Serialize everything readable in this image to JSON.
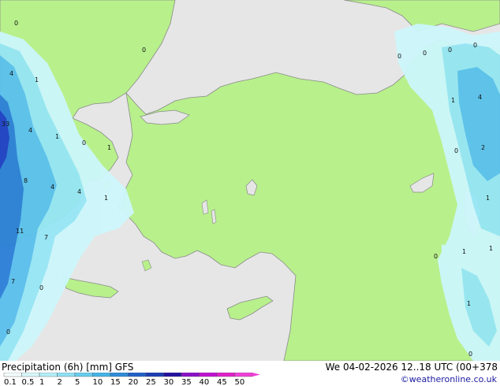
{
  "map": {
    "region": "Turkey / Eastern Mediterranean",
    "colors": {
      "sea": "#e6e6e6",
      "land": "#b8f08c",
      "coast": "#8a8a8a",
      "precip_light": "#cdf7fc",
      "precip_mid": "#96e6f5",
      "precip_heavy": "#5ac0ee",
      "precip_strong": "#2a7fd8",
      "precip_max": "#1e3ec8"
    },
    "point_values": [
      {
        "id": "v1",
        "text": "0"
      },
      {
        "id": "v2",
        "text": "0"
      },
      {
        "id": "v3",
        "text": "4"
      },
      {
        "id": "v4",
        "text": "1"
      },
      {
        "id": "v5",
        "text": "33"
      },
      {
        "id": "v6",
        "text": "4"
      },
      {
        "id": "v7",
        "text": "1"
      },
      {
        "id": "v8",
        "text": "0"
      },
      {
        "id": "v9",
        "text": "1"
      },
      {
        "id": "v10",
        "text": "8"
      },
      {
        "id": "v11",
        "text": "4"
      },
      {
        "id": "v12",
        "text": "4"
      },
      {
        "id": "v13",
        "text": "1"
      },
      {
        "id": "v14",
        "text": "11"
      },
      {
        "id": "v15",
        "text": "7"
      },
      {
        "id": "v16",
        "text": "7"
      },
      {
        "id": "v17",
        "text": "0"
      },
      {
        "id": "v18",
        "text": "0"
      },
      {
        "id": "v19",
        "text": "0"
      },
      {
        "id": "v20",
        "text": "0"
      },
      {
        "id": "v21",
        "text": "0"
      },
      {
        "id": "v22",
        "text": "0"
      },
      {
        "id": "v23",
        "text": "1"
      },
      {
        "id": "v24",
        "text": "4"
      },
      {
        "id": "v25",
        "text": "0"
      },
      {
        "id": "v26",
        "text": "2"
      },
      {
        "id": "v27",
        "text": "1"
      },
      {
        "id": "v28",
        "text": "0"
      },
      {
        "id": "v29",
        "text": "1"
      },
      {
        "id": "v30",
        "text": "1"
      },
      {
        "id": "v31",
        "text": "1"
      },
      {
        "id": "v32",
        "text": "0"
      }
    ]
  },
  "footer": {
    "title": "Precipitation (6h) [mm] GFS",
    "valid_time": "We 04-02-2026 12..18 UTC (00+378",
    "credit": "©weatheronline.co.uk"
  },
  "legend": {
    "labels": [
      "0.1",
      "0.5",
      "1",
      "2",
      "5",
      "10",
      "15",
      "20",
      "25",
      "30",
      "35",
      "40",
      "45",
      "50"
    ],
    "colors": [
      "#f5fdfe",
      "#d8f8fb",
      "#b4eef7",
      "#8fe0f3",
      "#69cdee",
      "#45b4e6",
      "#2f8cd9",
      "#2260c8",
      "#1b3cb4",
      "#2410a0",
      "#8a10c8",
      "#c010d2",
      "#e020c8",
      "#f040d8"
    ]
  }
}
